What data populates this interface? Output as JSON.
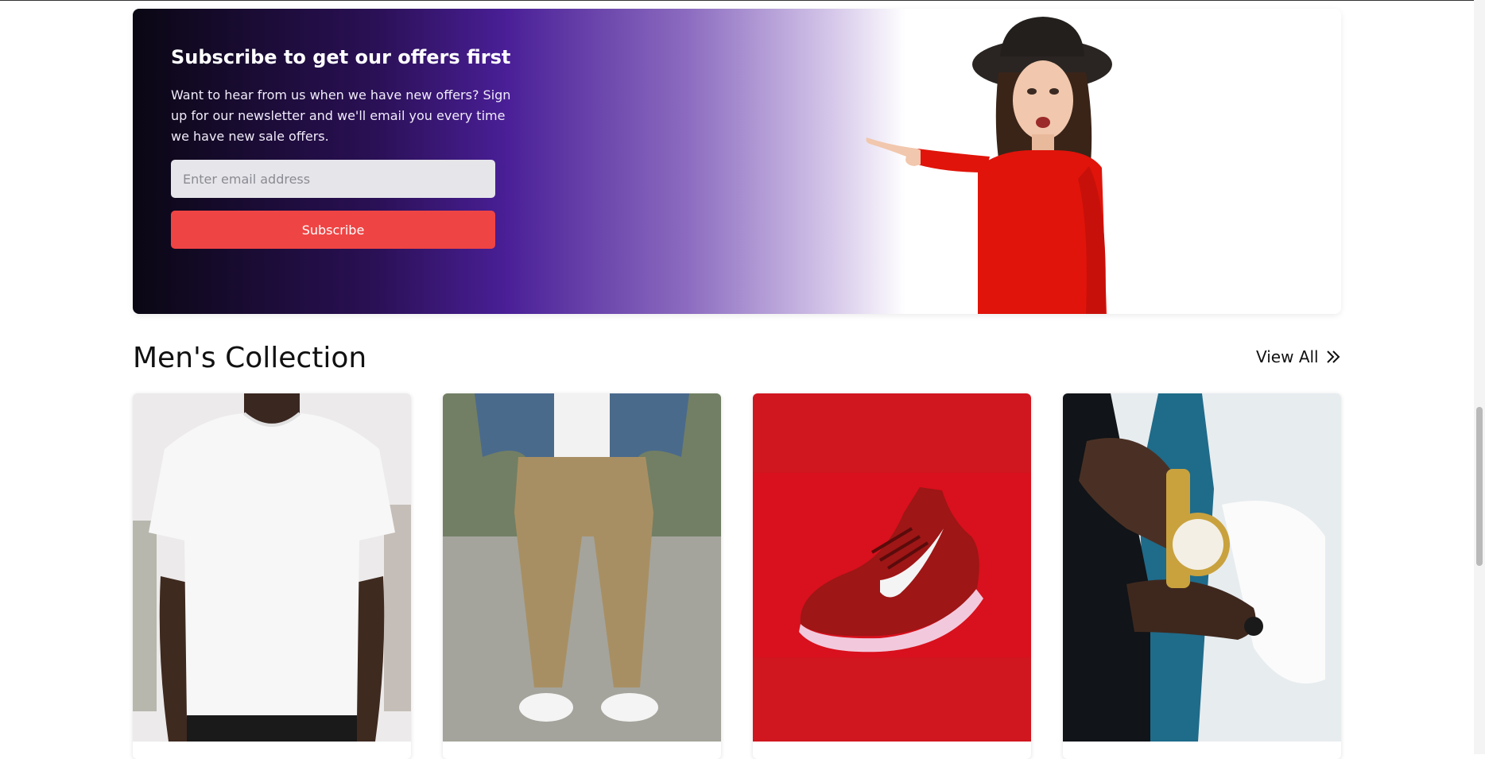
{
  "subscribe": {
    "title": "Subscribe to get our offers first",
    "description": "Want to hear from us when we have new offers? Sign up for our newsletter and we'll email you every time we have new sale offers.",
    "email_placeholder": "Enter email address",
    "button_label": "Subscribe",
    "accent": "#ef4444"
  },
  "collection": {
    "title": "Men's Collection",
    "view_all_label": "View All",
    "view_all_icon": "double-chevron-right-icon",
    "products": [
      {
        "image": "white-tshirt"
      },
      {
        "image": "khaki-pants-denim-jacket"
      },
      {
        "image": "red-sneaker"
      },
      {
        "image": "gold-wristwatch"
      }
    ]
  }
}
